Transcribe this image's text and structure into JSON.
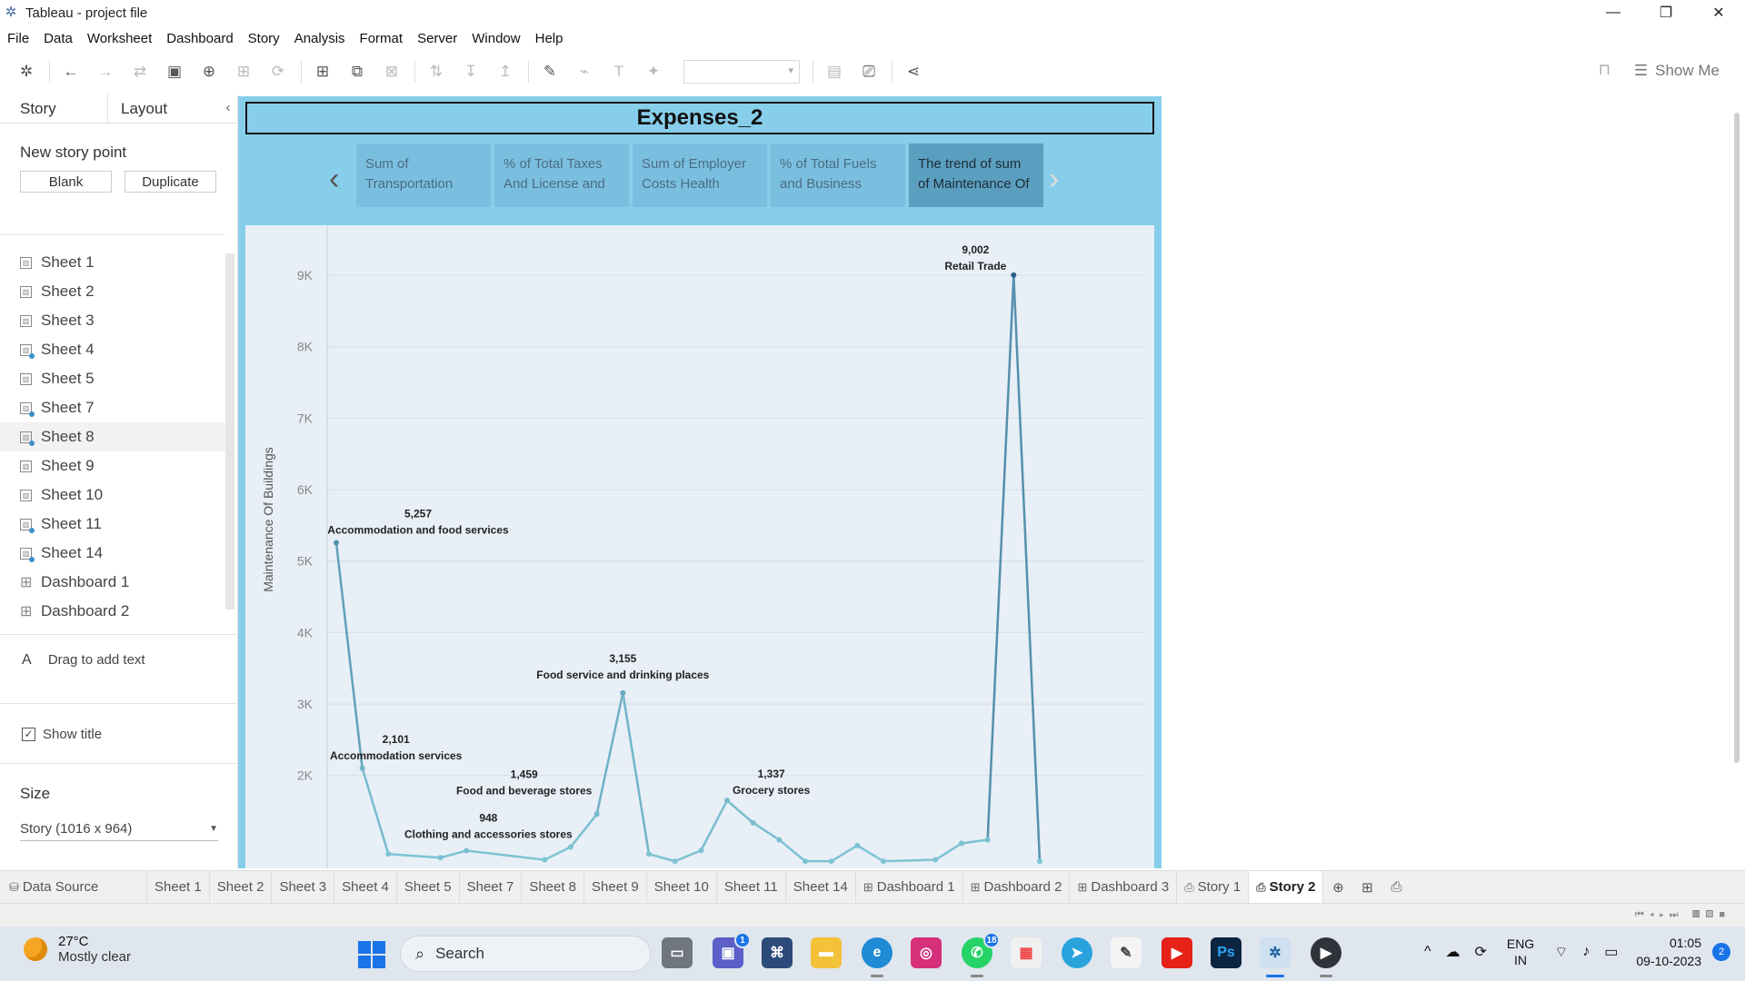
{
  "window": {
    "title": "Tableau - project file",
    "controls": [
      "—",
      "❐",
      "✕"
    ]
  },
  "menu": [
    "File",
    "Data",
    "Worksheet",
    "Dashboard",
    "Story",
    "Analysis",
    "Format",
    "Server",
    "Window",
    "Help"
  ],
  "toolbar": {
    "show_me": "Show Me"
  },
  "left_panel": {
    "tabs": {
      "story": "Story",
      "layout": "Layout"
    },
    "new_story_point": "New story point",
    "blank_button": "Blank",
    "duplicate_button": "Duplicate",
    "sheets": [
      {
        "label": "Sheet 1",
        "icon": "sheet"
      },
      {
        "label": "Sheet 2",
        "icon": "sheet"
      },
      {
        "label": "Sheet 3",
        "icon": "sheet"
      },
      {
        "label": "Sheet 4",
        "icon": "sheet-dot"
      },
      {
        "label": "Sheet 5",
        "icon": "sheet"
      },
      {
        "label": "Sheet 7",
        "icon": "sheet-dot"
      },
      {
        "label": "Sheet 8",
        "icon": "sheet-dot"
      },
      {
        "label": "Sheet 9",
        "icon": "sheet"
      },
      {
        "label": "Sheet 10",
        "icon": "sheet"
      },
      {
        "label": "Sheet 11",
        "icon": "sheet-dot"
      },
      {
        "label": "Sheet 14",
        "icon": "sheet-dot"
      },
      {
        "label": "Dashboard 1",
        "icon": "dashboard"
      },
      {
        "label": "Dashboard 2",
        "icon": "dashboard"
      }
    ],
    "drag_text": "Drag to add text",
    "show_title": "Show title",
    "size_heading": "Size",
    "size_value": "Story (1016 x 964)"
  },
  "story": {
    "title": "Expenses_2",
    "points": [
      "Sum of Transportation",
      "% of Total Taxes And License and",
      "Sum of Employer Costs Health",
      "% of Total Fuels and Business",
      "The trend of sum of Maintenance Of"
    ],
    "active_point": 4
  },
  "chart_data": {
    "type": "line",
    "ylabel": "Maintenance Of Buildings",
    "yticks": [
      "9K",
      "8K",
      "7K",
      "6K",
      "5K",
      "4K",
      "3K",
      "2K"
    ],
    "ylim": [
      700,
      9700
    ],
    "grid": true,
    "x_index_range": [
      0,
      30
    ],
    "points": [
      {
        "x": 0,
        "y": 5257,
        "label": "5,257",
        "name": "Accommodation and food services"
      },
      {
        "x": 1,
        "y": 2101,
        "label": "2,101",
        "name": "Accommodation services"
      },
      {
        "x": 2,
        "y": 900
      },
      {
        "x": 4,
        "y": 850
      },
      {
        "x": 5,
        "y": 948,
        "label": "948",
        "name": "Clothing and accessories stores"
      },
      {
        "x": 8,
        "y": 820
      },
      {
        "x": 9,
        "y": 1000
      },
      {
        "x": 10,
        "y": 1459,
        "label": "1,459",
        "name": "Food and beverage stores"
      },
      {
        "x": 11,
        "y": 3155,
        "label": "3,155",
        "name": "Food service and drinking places"
      },
      {
        "x": 12,
        "y": 900
      },
      {
        "x": 13,
        "y": 800
      },
      {
        "x": 14,
        "y": 950
      },
      {
        "x": 15,
        "y": 1650
      },
      {
        "x": 16,
        "y": 1337,
        "label": "1,337",
        "name": "Grocery stores"
      },
      {
        "x": 17,
        "y": 1100
      },
      {
        "x": 18,
        "y": 800
      },
      {
        "x": 19,
        "y": 800
      },
      {
        "x": 20,
        "y": 1020
      },
      {
        "x": 21,
        "y": 800
      },
      {
        "x": 23,
        "y": 820
      },
      {
        "x": 24,
        "y": 1050
      },
      {
        "x": 25,
        "y": 1100
      },
      {
        "x": 26,
        "y": 9002,
        "label": "9,002",
        "name": "Retail Trade"
      },
      {
        "x": 27,
        "y": 800
      }
    ]
  },
  "sheet_tabs": [
    {
      "label": "Data Source",
      "icon": "data",
      "kind": "ds"
    },
    {
      "label": "Sheet 1"
    },
    {
      "label": "Sheet 2"
    },
    {
      "label": "Sheet 3"
    },
    {
      "label": "Sheet 4"
    },
    {
      "label": "Sheet 5"
    },
    {
      "label": "Sheet 7"
    },
    {
      "label": "Sheet 8"
    },
    {
      "label": "Sheet 9"
    },
    {
      "label": "Sheet 10"
    },
    {
      "label": "Sheet 11"
    },
    {
      "label": "Sheet 14"
    },
    {
      "label": "Dashboard 1",
      "icon": "dashboard"
    },
    {
      "label": "Dashboard 2",
      "icon": "dashboard"
    },
    {
      "label": "Dashboard 3",
      "icon": "dashboard"
    },
    {
      "label": "Story 1",
      "icon": "story"
    },
    {
      "label": "Story 2",
      "icon": "story",
      "active": true
    }
  ],
  "taskbar": {
    "weather_temp": "27°C",
    "weather_desc": "Mostly clear",
    "search": "Search",
    "teams_badge": "1",
    "whatsapp_badge": "18",
    "lang_line1": "ENG",
    "lang_line2": "IN",
    "time": "01:05",
    "date": "09-10-2023",
    "notifications": "2"
  }
}
